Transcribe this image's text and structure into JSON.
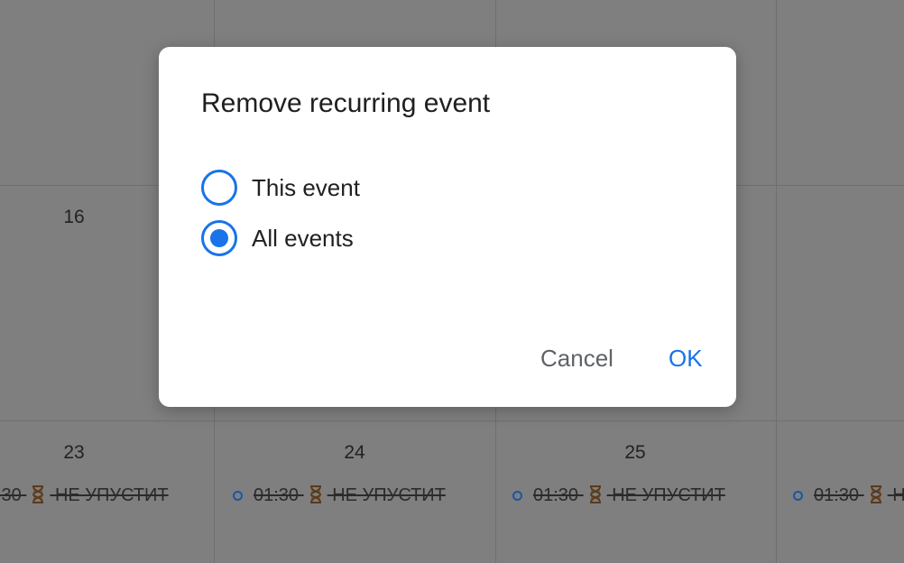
{
  "calendar": {
    "day_16": "16",
    "day_23": "23",
    "day_24": "24",
    "day_25": "25",
    "event_partial": ":30",
    "event_time": "01:30",
    "event_title": "НЕ УПУСТИТ",
    "event_icon": "hourglass-icon"
  },
  "dialog": {
    "title": "Remove recurring event",
    "options": [
      {
        "label": "This event",
        "checked": false
      },
      {
        "label": "All events",
        "checked": true
      }
    ],
    "cancel_label": "Cancel",
    "ok_label": "OK"
  },
  "colors": {
    "overlay": "#7f7f7f",
    "accent": "#1a73e8"
  }
}
